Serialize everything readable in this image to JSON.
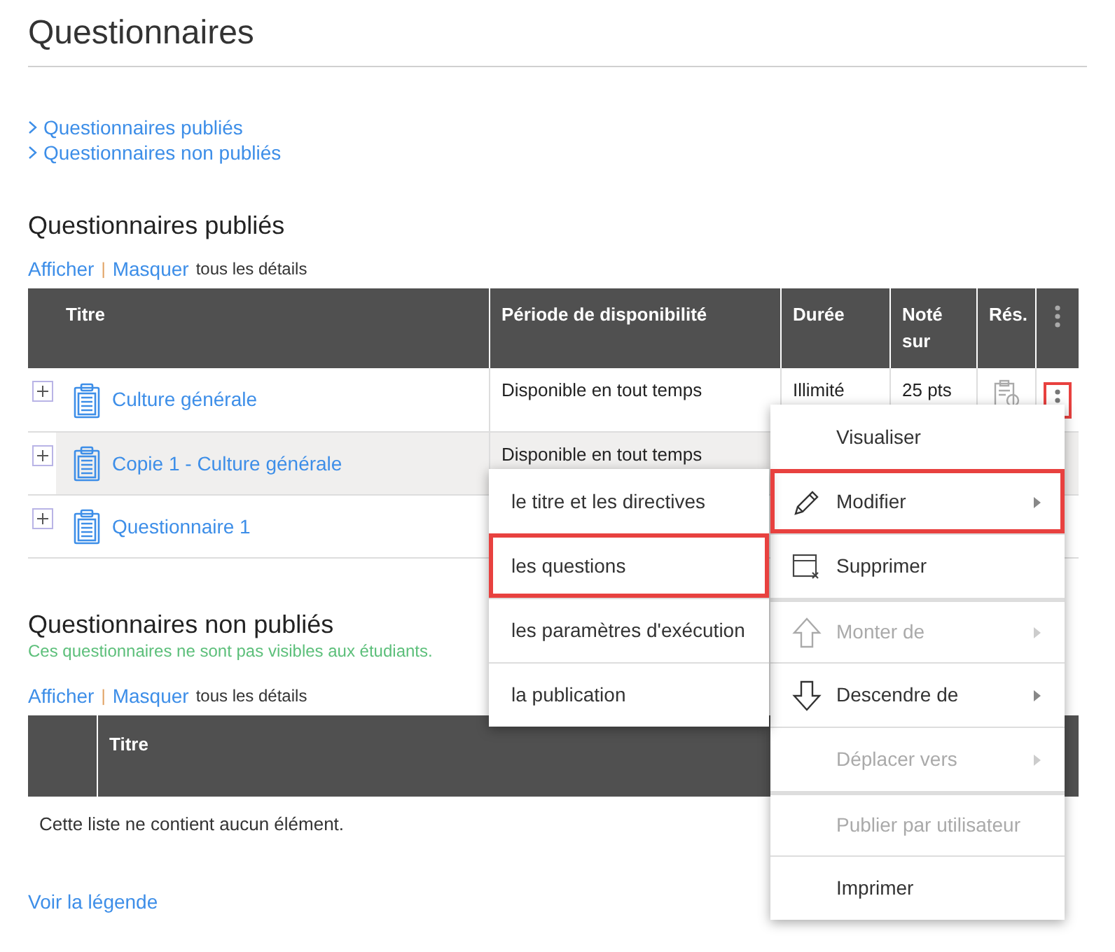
{
  "title": "Questionnaires",
  "nav_links": [
    "Questionnaires publiés",
    "Questionnaires non publiés"
  ],
  "published": {
    "heading": "Questionnaires publiés",
    "toggle": {
      "show": "Afficher",
      "separator": "|",
      "hide": "Masquer",
      "suffix": "tous les détails"
    },
    "columns": [
      "Titre",
      "Période de disponibilité",
      "Durée",
      "Noté sur",
      "Rés."
    ],
    "rows": [
      {
        "title": "Culture générale",
        "period": "Disponible en tout temps",
        "duration": "Illimité",
        "points": "25 pts",
        "results_icon": true,
        "selected": false,
        "menu_focused": true
      },
      {
        "title": "Copie 1 - Culture générale",
        "period": "Disponible en tout temps",
        "selected": true
      },
      {
        "title": "Questionnaire 1",
        "selected": false
      }
    ]
  },
  "unpublished": {
    "heading": "Questionnaires non publiés",
    "note": "Ces questionnaires ne sont pas visibles aux étudiants.",
    "toggle": {
      "show": "Afficher",
      "separator": "|",
      "hide": "Masquer",
      "suffix": "tous les détails"
    },
    "columns": [
      "Titre"
    ],
    "empty_message": "Cette liste ne contient aucun élément."
  },
  "legend_link": "Voir la légende",
  "context_menu": [
    {
      "label": "Visualiser",
      "kind": "plain",
      "disabled": false,
      "submenu": false,
      "selected": false,
      "group_start": false
    },
    {
      "label": "Modifier",
      "kind": "pencil",
      "disabled": false,
      "submenu": true,
      "selected": true,
      "group_start": false
    },
    {
      "label": "Supprimer",
      "kind": "delete",
      "disabled": false,
      "submenu": false,
      "selected": false,
      "group_start": false
    },
    {
      "label": "Monter de",
      "kind": "up",
      "disabled": true,
      "submenu": true,
      "selected": false,
      "group_start": true
    },
    {
      "label": "Descendre de",
      "kind": "down",
      "disabled": false,
      "submenu": true,
      "selected": false,
      "group_start": false
    },
    {
      "label": "Déplacer vers",
      "kind": "plain",
      "disabled": true,
      "submenu": true,
      "selected": false,
      "group_start": false
    },
    {
      "label": "Publier par utilisateur",
      "kind": "plain",
      "disabled": true,
      "submenu": false,
      "selected": false,
      "group_start": true
    },
    {
      "label": "Imprimer",
      "kind": "plain",
      "disabled": false,
      "submenu": false,
      "selected": false,
      "group_start": false
    }
  ],
  "submenu": [
    {
      "label": "le titre et les directives",
      "selected": false
    },
    {
      "label": "les questions",
      "selected": true
    },
    {
      "label": "les paramètres d'exécution",
      "selected": false
    },
    {
      "label": "la publication",
      "selected": false
    }
  ]
}
